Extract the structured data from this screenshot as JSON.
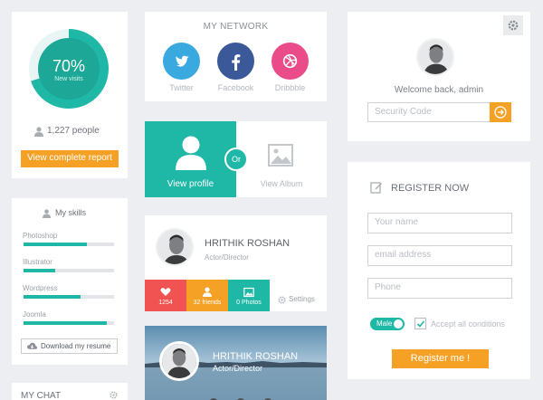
{
  "visits": {
    "percent_label": "70%",
    "sub_label": "New visits",
    "fraction": 0.7,
    "people_count": "1,227 people",
    "report_button": "View complete report"
  },
  "skills": {
    "title": "My skills",
    "items": [
      {
        "label": "Photoshop",
        "level": 0.7
      },
      {
        "label": "Illustrator",
        "level": 0.35
      },
      {
        "label": "Wordpress",
        "level": 0.63
      },
      {
        "label": "Joomla",
        "level": 0.92
      }
    ],
    "download_button": "Download my resume"
  },
  "chat": {
    "title": "MY CHAT"
  },
  "network": {
    "title": "MY NETWORK",
    "items": [
      {
        "label": "Twitter",
        "color": "#3aa9df",
        "icon": "twitter-icon"
      },
      {
        "label": "Facebook",
        "color": "#3b5998",
        "icon": "facebook-icon"
      },
      {
        "label": "Dribbble",
        "color": "#ea4c89",
        "icon": "dribbble-icon"
      }
    ]
  },
  "profile_switch": {
    "view_profile": "View profile",
    "or": "Or",
    "view_album": "View Album"
  },
  "profile_card": {
    "name": "HRITHIK ROSHAN",
    "role": "Actor/Director",
    "stats": [
      {
        "value": "1254",
        "icon": "heart-icon",
        "color": "#f05352"
      },
      {
        "value": "32 friends",
        "icon": "user-icon",
        "color": "#f4a125"
      },
      {
        "value": "0 Photos",
        "icon": "photo-icon",
        "color": "#1fb7a6"
      }
    ],
    "settings_label": "Settings"
  },
  "cover_card": {
    "name": "HRITHIK ROSHAN",
    "role": "Actor/Director"
  },
  "login": {
    "welcome": "Welcome back, admin",
    "security_placeholder": "Security Code"
  },
  "register": {
    "title": "REGISTER NOW",
    "name_placeholder": "Your name",
    "email_placeholder": "email address",
    "phone_placeholder": "Phone",
    "gender_toggle": "Male",
    "accept_label": "Accept all conditions",
    "submit_button": "Register me !"
  },
  "colors": {
    "accent": "#1fb7a6",
    "orange": "#f4a125",
    "red": "#f05352"
  }
}
